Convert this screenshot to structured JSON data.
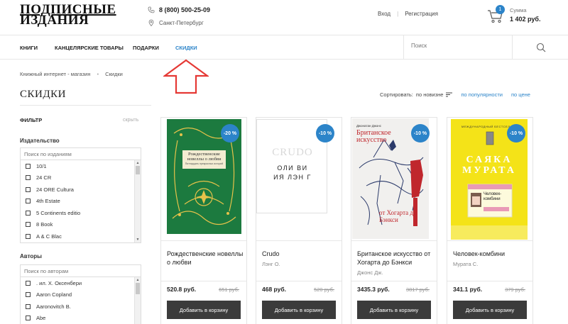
{
  "header": {
    "logo_line1": "ПОДПИСНЫЕ",
    "logo_line2": "ИЗДАНИЯ",
    "phone": "8 (800) 500-25-09",
    "city": "Санкт-Петербург",
    "login": "Вход",
    "register": "Регистрация",
    "cart_count": "1",
    "sum_label": "Сумма",
    "sum_value": "1 402 руб."
  },
  "nav": {
    "items": [
      {
        "label": "КНИГИ"
      },
      {
        "label": "КАНЦЕЛЯРСКИЕ ТОВАРЫ"
      },
      {
        "label": "ПОДАРКИ"
      },
      {
        "label": "СКИДКИ"
      }
    ],
    "active_color": "#2c84c9",
    "search_placeholder": "Поиск"
  },
  "breadcrumb": [
    "Книжный интернет - магазин",
    "Скидки"
  ],
  "page_title": "СКИДКИ",
  "sort": {
    "label": "Сортировать:",
    "current": "по новизне",
    "options": [
      "по популярности",
      "по цене"
    ]
  },
  "filter": {
    "title": "ФИЛЬТР",
    "hide": "скрыть",
    "publishers": {
      "title": "Издательство",
      "placeholder": "Поиск по изданиям",
      "items": [
        "10/1",
        "24 СR",
        "24 ORE Cultura",
        "4th Estate",
        "5 Continents editio",
        "8 Book",
        "A & C Blac"
      ]
    },
    "authors": {
      "title": "Авторы",
      "placeholder": "Поиск по авторам",
      "items": [
        ". ил. Х. Оксенбери",
        "Aaron Copland",
        "Aaronovitch B.",
        "Abe"
      ]
    }
  },
  "products": [
    {
      "discount": "-20 %",
      "title": "Рождественские новеллы о любви",
      "author": "",
      "price": "520.8 руб.",
      "old_price": "651 руб.",
      "button": "Добавить в корзину",
      "cover_text": "Рождественские новеллы о любви",
      "cover_subtext": "Пятнадцать прекрасных историй"
    },
    {
      "discount": "-10 %",
      "title": "Crudo",
      "author": "Лэнг О.",
      "price": "468 руб.",
      "old_price": "520 руб.",
      "button": "Добавить в корзину",
      "cover_text": "CRUDO",
      "cover_subtext": "ОЛИ ВИ ИЯ ЛЭН Г"
    },
    {
      "discount": "-10 %",
      "title": "Британское искусство от Хогарта до Бэнкси",
      "author": "Джонс Дж.",
      "price": "3435.3 руб.",
      "old_price": "3817 руб.",
      "button": "Добавить в корзину",
      "cover_text": "Британское искусство",
      "cover_subtext": "от Хогарта до Бэнкси",
      "cover_author": "Джонатан Джонс"
    },
    {
      "discount": "-10 %",
      "title": "Человек-комбини",
      "author": "Мурата С.",
      "price": "341.1 руб.",
      "old_price": "379 руб.",
      "button": "Добавить в корзину",
      "cover_text": "САЯКА МУРАТА",
      "cover_subtext": "Человек-комбини",
      "cover_top": "МЕЖДУНАРОДНЫЙ БЕСТСЕЛЛЕР"
    }
  ],
  "colors": {
    "accent": "#2c84c9",
    "button": "#3b3b3b",
    "annotation_arrow": "#e53935"
  }
}
